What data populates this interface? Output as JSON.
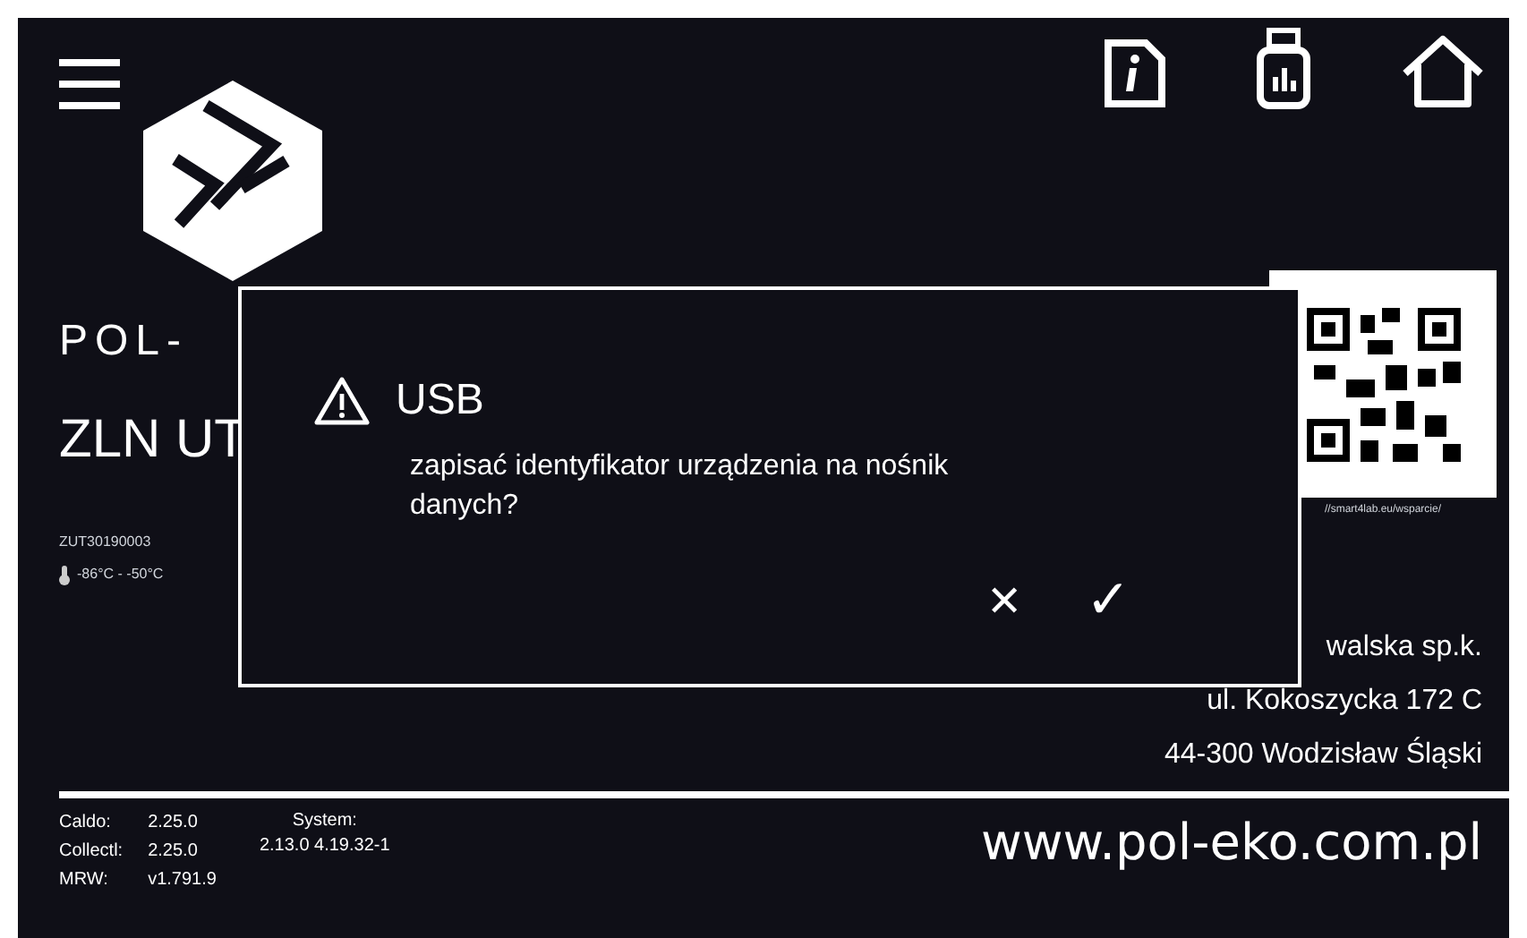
{
  "device": {
    "brand": "POL-",
    "model": "ZLN UT",
    "serial": "ZUT30190003",
    "temperature_range": "-86°C - -50°C"
  },
  "qr": {
    "caption": "//smart4lab.eu/wsparcie/"
  },
  "address": [
    "walska sp.k.",
    "ul. Kokoszycka 172 C",
    "44-300 Wodzisław Śląski"
  ],
  "versions": [
    {
      "label": "Caldo:",
      "value": "2.25.0"
    },
    {
      "label": "Collectl:",
      "value": "2.25.0"
    },
    {
      "label": "MRW:",
      "value": "v1.791.9"
    }
  ],
  "system": {
    "label": "System:",
    "value": "2.13.0 4.19.32-1"
  },
  "website": "www.pol-eko.com.pl",
  "dialog": {
    "title": "USB",
    "message": "zapisać identyfikator urządzenia na nośnik danych?",
    "buttons": [
      {
        "kind": "cancel",
        "label": "✕"
      },
      {
        "kind": "confirm",
        "label": "✓"
      }
    ]
  }
}
